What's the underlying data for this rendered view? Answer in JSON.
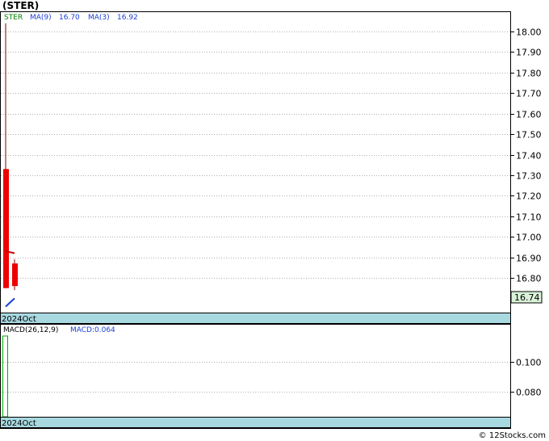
{
  "header": {
    "title": "(STER)"
  },
  "legend": {
    "symbol": "STER",
    "ma9_label": "MA(9)",
    "ma9_value": "16.70",
    "ma3_label": "MA(3)",
    "ma3_value": "16.92"
  },
  "price_panel": {
    "last_price_label": "16.74",
    "time_label": "2024Oct"
  },
  "macd_panel": {
    "label": "MACD(26,12,9)",
    "value_label": "MACD:0.064",
    "time_label": "2024Oct"
  },
  "footer": {
    "credit": "© 12Stocks.com"
  },
  "colors": {
    "up_candle": "#00aa00",
    "down_candle": "#ee0000",
    "ma3": "#cc0000",
    "ma9": "#1a3fd8",
    "axis_band": "#a8d8e0",
    "last_price_box": "#d9f2d9",
    "grid": "#b0b0b0"
  },
  "chart_data": [
    {
      "type": "candlestick",
      "ylim": [
        16.64,
        18.1
      ],
      "yticks": [
        18.0,
        17.9,
        17.8,
        17.7,
        17.6,
        17.5,
        17.4,
        17.3,
        17.2,
        17.1,
        17.0,
        16.9,
        16.8
      ],
      "ytick_labels": [
        "18.00",
        "17.90",
        "17.80",
        "17.70",
        "17.60",
        "17.50",
        "17.40",
        "17.30",
        "17.20",
        "17.10",
        "17.00",
        "16.90",
        "16.80"
      ],
      "x_label": "2024Oct",
      "candles": [
        {
          "open": 17.33,
          "high": 18.04,
          "low": 16.75,
          "close": 16.75
        },
        {
          "open": 16.87,
          "high": 16.89,
          "low": 16.74,
          "close": 16.76
        }
      ],
      "ma3": [
        16.93,
        16.92
      ],
      "ma9": [
        16.66,
        16.7
      ],
      "last_price": 16.74
    },
    {
      "type": "bar",
      "title": "MACD(26,12,9)",
      "ylim": [
        0.064,
        0.124
      ],
      "yticks": [
        0.1,
        0.08
      ],
      "ytick_labels": [
        "0.100",
        "0.080"
      ],
      "x_label": "2024Oct",
      "values": [
        0.13
      ]
    }
  ]
}
